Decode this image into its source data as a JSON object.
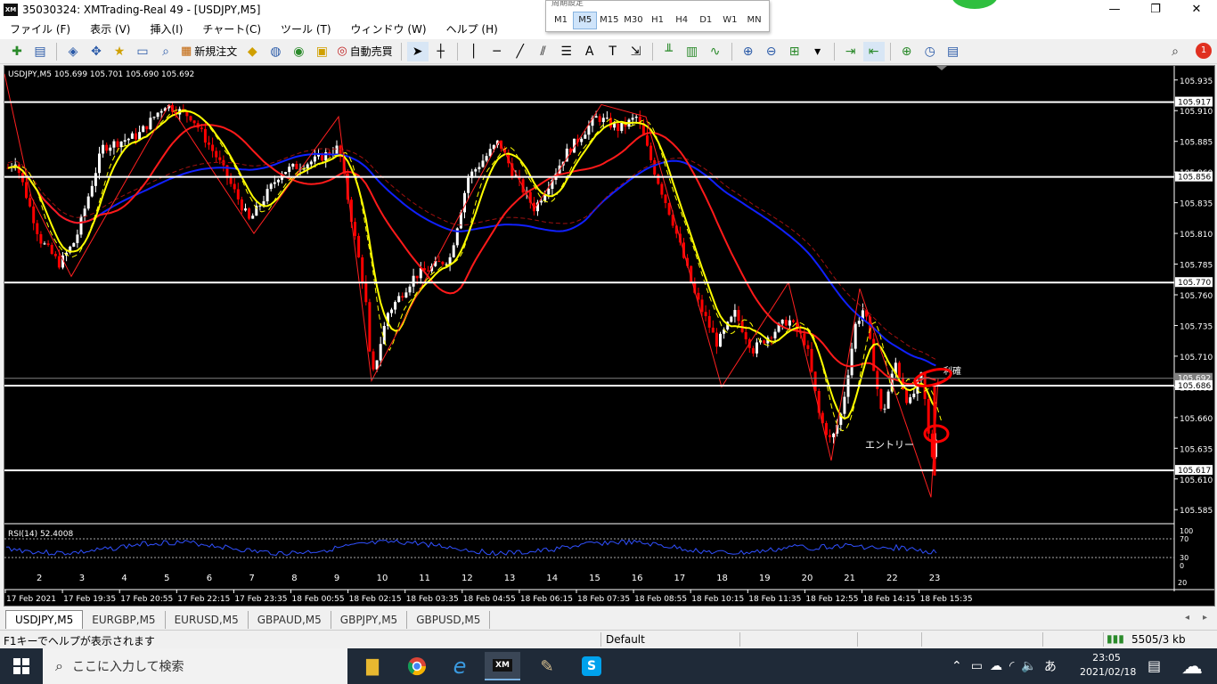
{
  "window": {
    "title": "35030324: XMTrading-Real 49 - [USDJPY,M5]",
    "minimize": "—",
    "maximize": "❐",
    "close": "✕",
    "mdi_controls": [
      "_",
      "❐",
      "✕"
    ]
  },
  "menu": {
    "items": [
      "ファイル (F)",
      "表示 (V)",
      "挿入(I)",
      "チャート(C)",
      "ツール (T)",
      "ウィンドウ (W)",
      "ヘルプ (H)"
    ]
  },
  "toolbar": {
    "new_order": "新規注文",
    "auto_trading": "自動売買",
    "notification_count": "1"
  },
  "timeframe_popup": {
    "header": "周期設定",
    "items": [
      "M1",
      "M5",
      "M15",
      "M30",
      "H1",
      "H4",
      "D1",
      "W1",
      "MN"
    ],
    "selected": "M5"
  },
  "chart": {
    "info": "USDJPY,M5  105.699 105.701 105.690 105.692",
    "rsi_label": "RSI(14) 52.4008",
    "entry_label": "エントリー",
    "profit_label": "利確",
    "price_ticks": [
      "105.935",
      "105.910",
      "105.885",
      "105.860",
      "105.835",
      "105.810",
      "105.785",
      "105.760",
      "105.735",
      "105.710",
      "105.685",
      "105.660",
      "105.635",
      "105.610",
      "105.585"
    ],
    "line_labels": [
      "105.917",
      "105.856",
      "105.770",
      "105.692",
      "105.686",
      "105.617"
    ],
    "rsi_ticks": [
      "100",
      "70",
      "30",
      "0"
    ],
    "number_row": [
      "2",
      "3",
      "4",
      "5",
      "6",
      "7",
      "8",
      "9",
      "10",
      "11",
      "12",
      "13",
      "14",
      "15",
      "16",
      "17",
      "18",
      "19",
      "20",
      "21",
      "22",
      "23"
    ],
    "time_axis": [
      "17 Feb 2021",
      "17 Feb 19:35",
      "17 Feb 20:55",
      "17 Feb 22:15",
      "17 Feb 23:35",
      "18 Feb 00:55",
      "18 Feb 02:15",
      "18 Feb 03:35",
      "18 Feb 04:55",
      "18 Feb 06:15",
      "18 Feb 07:35",
      "18 Feb 08:55",
      "18 Feb 10:15",
      "18 Feb 11:35",
      "18 Feb 12:55",
      "18 Feb 14:15",
      "18 Feb 15:35"
    ],
    "corner_label": "20"
  },
  "tabs": [
    "USDJPY,M5",
    "EURGBP,M5",
    "EURUSD,M5",
    "GBPAUD,M5",
    "GBPJPY,M5",
    "GBPUSD,M5"
  ],
  "status": {
    "help": "F1キーでヘルプが表示されます",
    "profile": "Default",
    "traffic": "5505/3 kb"
  },
  "taskbar": {
    "search_placeholder": "ここに入力して検索",
    "time": "23:05",
    "date": "2021/02/18",
    "ime": "あ"
  }
}
